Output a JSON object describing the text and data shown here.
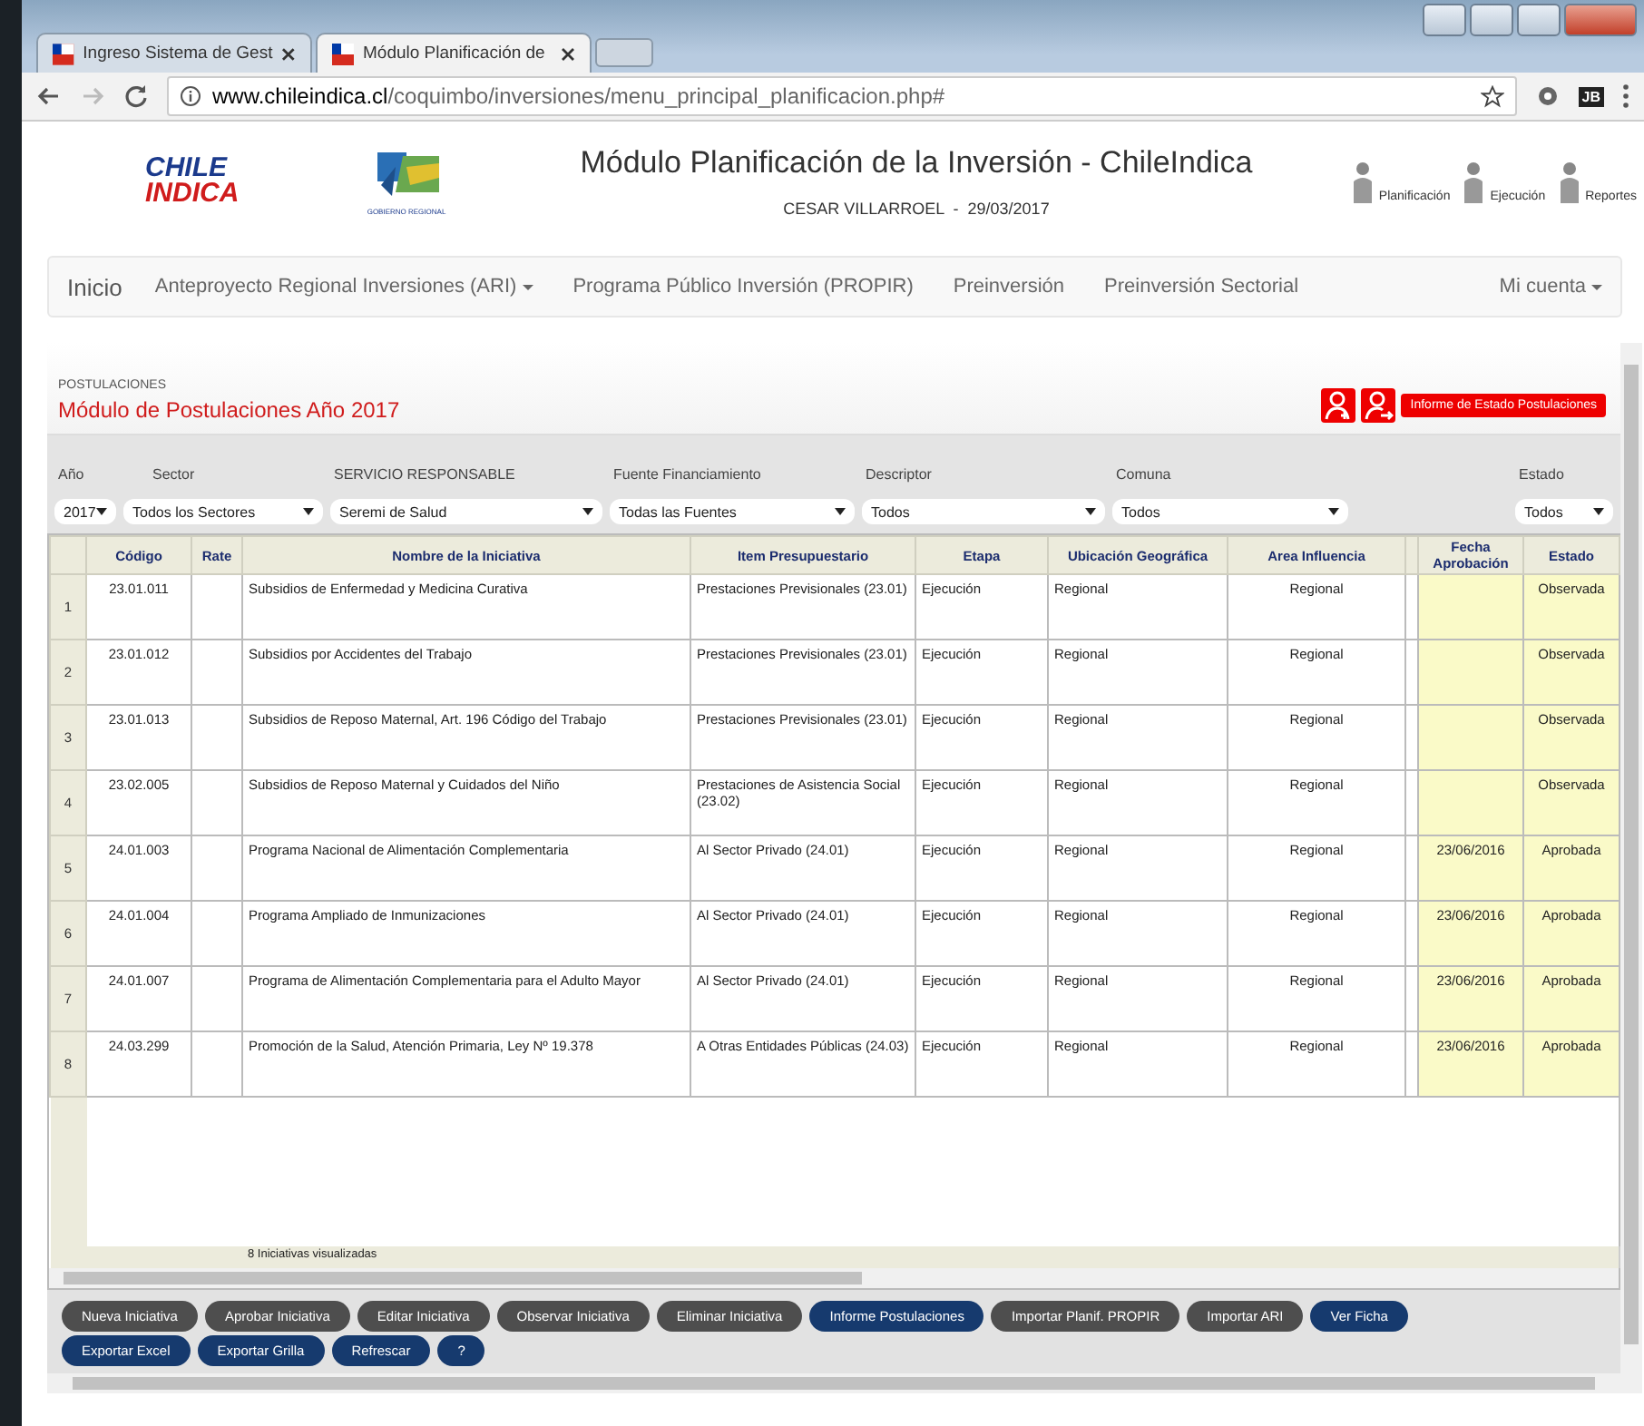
{
  "browser": {
    "tabs": [
      {
        "title": "Ingreso Sistema de Gest",
        "selected": false
      },
      {
        "title": "Módulo Planificación de",
        "selected": true
      }
    ],
    "url": {
      "host": "www.chileindica.cl",
      "path": "/coquimbo/inversiones/menu_principal_planificacion.php#"
    },
    "extension_label": "JB"
  },
  "header": {
    "logo_top": "CHILE",
    "logo_bottom": "INDICA",
    "region_logo_caption": "GOBIERNO REGIONAL",
    "title": "Módulo Planificación de la Inversión - ChileIndica",
    "user": "CESAR VILLARROEL  -  29/03/2017",
    "actions": [
      {
        "label": "Planificación"
      },
      {
        "label": "Ejecución"
      },
      {
        "label": "Reportes"
      }
    ]
  },
  "nav": {
    "brand": "Inicio",
    "items": [
      {
        "label": "Anteproyecto Regional Inversiones (ARI)",
        "dropdown": true
      },
      {
        "label": "Programa Público Inversión (PROPIR)",
        "dropdown": false
      },
      {
        "label": "Preinversión",
        "dropdown": false
      },
      {
        "label": "Preinversión Sectorial",
        "dropdown": false
      }
    ],
    "account": {
      "label": "Mi cuenta",
      "dropdown": true
    }
  },
  "module": {
    "section": "POSTULACIONES",
    "title": "Módulo de Postulaciones Año 2017",
    "report_button": "Informe de Estado Postulaciones"
  },
  "filters": [
    {
      "label": "Año",
      "value": "2017"
    },
    {
      "label": "Sector",
      "value": "Todos los Sectores"
    },
    {
      "label": "SERVICIO RESPONSABLE",
      "value": "Seremi de Salud"
    },
    {
      "label": "Fuente Financiamiento",
      "value": "Todas las Fuentes"
    },
    {
      "label": "Descriptor",
      "value": "Todos"
    },
    {
      "label": "Comuna",
      "value": "Todos"
    },
    {
      "label": "Estado",
      "value": "Todos"
    }
  ],
  "table": {
    "columns": [
      "Código",
      "Rate",
      "Nombre de la Iniciativa",
      "Item Presupuestario",
      "Etapa",
      "Ubicación Geográfica",
      "Area Influencia",
      "Fecha Aprobación",
      "Estado"
    ],
    "rows": [
      {
        "n": "1",
        "codigo": "23.01.011",
        "nombre": "Subsidios de Enfermedad y Medicina Curativa",
        "item": "Prestaciones Previsionales (23.01)",
        "etapa": "Ejecución",
        "ubicacion": "Regional",
        "area": "Regional",
        "fecha": "",
        "estado": "Observada"
      },
      {
        "n": "2",
        "codigo": "23.01.012",
        "nombre": "Subsidios por Accidentes del Trabajo",
        "item": "Prestaciones Previsionales (23.01)",
        "etapa": "Ejecución",
        "ubicacion": "Regional",
        "area": "Regional",
        "fecha": "",
        "estado": "Observada"
      },
      {
        "n": "3",
        "codigo": "23.01.013",
        "nombre": "Subsidios de Reposo Maternal, Art. 196 Código del Trabajo",
        "item": "Prestaciones Previsionales (23.01)",
        "etapa": "Ejecución",
        "ubicacion": "Regional",
        "area": "Regional",
        "fecha": "",
        "estado": "Observada"
      },
      {
        "n": "4",
        "codigo": "23.02.005",
        "nombre": "Subsidios de Reposo Maternal y Cuidados del Niño",
        "item": "Prestaciones de Asistencia Social (23.02)",
        "etapa": "Ejecución",
        "ubicacion": "Regional",
        "area": "Regional",
        "fecha": "",
        "estado": "Observada"
      },
      {
        "n": "5",
        "codigo": "24.01.003",
        "nombre": "Programa Nacional de Alimentación Complementaria",
        "item": "Al Sector Privado (24.01)",
        "etapa": "Ejecución",
        "ubicacion": "Regional",
        "area": "Regional",
        "fecha": "23/06/2016",
        "estado": "Aprobada"
      },
      {
        "n": "6",
        "codigo": "24.01.004",
        "nombre": "Programa Ampliado de Inmunizaciones",
        "item": "Al Sector Privado (24.01)",
        "etapa": "Ejecución",
        "ubicacion": "Regional",
        "area": "Regional",
        "fecha": "23/06/2016",
        "estado": "Aprobada"
      },
      {
        "n": "7",
        "codigo": "24.01.007",
        "nombre": "Programa de Alimentación Complementaria para el Adulto Mayor",
        "item": "Al Sector Privado (24.01)",
        "etapa": "Ejecución",
        "ubicacion": "Regional",
        "area": "Regional",
        "fecha": "23/06/2016",
        "estado": "Aprobada"
      },
      {
        "n": "8",
        "codigo": "24.03.299",
        "nombre": "Promoción de la Salud, Atención Primaria, Ley Nº 19.378",
        "item": "A Otras Entidades Públicas (24.03)",
        "etapa": "Ejecución",
        "ubicacion": "Regional",
        "area": "Regional",
        "fecha": "23/06/2016",
        "estado": "Aprobada"
      }
    ],
    "footer": "8 Iniciativas visualizadas"
  },
  "buttons": [
    {
      "label": "Nueva Iniciativa",
      "kind": "secondary"
    },
    {
      "label": "Aprobar Iniciativa",
      "kind": "secondary"
    },
    {
      "label": "Editar Iniciativa",
      "kind": "secondary"
    },
    {
      "label": "Observar Iniciativa",
      "kind": "secondary"
    },
    {
      "label": "Eliminar Iniciativa",
      "kind": "secondary"
    },
    {
      "label": "Informe Postulaciones",
      "kind": "primary"
    },
    {
      "label": "Importar Planif. PROPIR",
      "kind": "secondary"
    },
    {
      "label": "Importar ARI",
      "kind": "secondary"
    },
    {
      "label": "Ver Ficha",
      "kind": "primary"
    },
    {
      "label": "Exportar Excel",
      "kind": "primary"
    },
    {
      "label": "Exportar Grilla",
      "kind": "primary"
    },
    {
      "label": "Refrescar",
      "kind": "primary"
    },
    {
      "label": "?",
      "kind": "primary"
    }
  ]
}
